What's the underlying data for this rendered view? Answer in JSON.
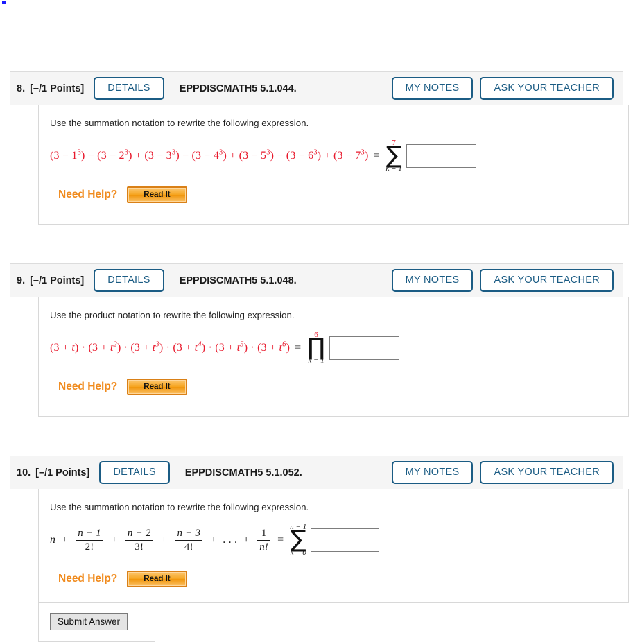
{
  "page": {
    "background_color": "#ffffff",
    "accent_blue": "#1b5c84",
    "expression_red": "#e8192c",
    "help_orange": "#f08b1e"
  },
  "common": {
    "details_label": "DETAILS",
    "my_notes_label": "MY NOTES",
    "ask_your_teacher_label": "ASK YOUR TEACHER",
    "need_help_label": "Need Help?",
    "read_it_label": "Read It",
    "points_label": "[–/1 Points]",
    "answer_placeholder": ""
  },
  "questions": [
    {
      "number": "8.",
      "points": "[–/1 Points]",
      "tag": "EPPDISCMATH5 5.1.044.",
      "prompt": "Use the summation notation to rewrite the following expression.",
      "expression_plain": "(3 − 1³) − (3 − 2³) + (3 − 3³) − (3 − 4³) + (3 − 5³) − (3 − 6³) + (3 − 7³)",
      "terms": [
        {
          "sign": "",
          "base": "3",
          "op": "−",
          "term": "1",
          "exp": "3"
        },
        {
          "sign": "−",
          "base": "3",
          "op": "−",
          "term": "2",
          "exp": "3"
        },
        {
          "sign": "+",
          "base": "3",
          "op": "−",
          "term": "3",
          "exp": "3"
        },
        {
          "sign": "−",
          "base": "3",
          "op": "−",
          "term": "4",
          "exp": "3"
        },
        {
          "sign": "+",
          "base": "3",
          "op": "−",
          "term": "5",
          "exp": "3"
        },
        {
          "sign": "−",
          "base": "3",
          "op": "−",
          "term": "6",
          "exp": "3"
        },
        {
          "sign": "+",
          "base": "3",
          "op": "−",
          "term": "7",
          "exp": "3"
        }
      ],
      "equals": "=",
      "operator": {
        "glyph": "∑",
        "name": "sigma-summation",
        "upper": "7",
        "lower": "k = 1",
        "upper_color": "#e8192c"
      },
      "answer_value": ""
    },
    {
      "number": "9.",
      "points": "[–/1 Points]",
      "tag": "EPPDISCMATH5 5.1.048.",
      "prompt": "Use the product notation to rewrite the following expression.",
      "expression_plain": "(3 + t) · (3 + t²) · (3 + t³) · (3 + t⁴) · (3 + t⁵) · (3 + t⁶)",
      "terms": [
        {
          "sep": "",
          "base": "3",
          "op": "+",
          "term": "t",
          "exp": ""
        },
        {
          "sep": "·",
          "base": "3",
          "op": "+",
          "term": "t",
          "exp": "2"
        },
        {
          "sep": "·",
          "base": "3",
          "op": "+",
          "term": "t",
          "exp": "3"
        },
        {
          "sep": "·",
          "base": "3",
          "op": "+",
          "term": "t",
          "exp": "4"
        },
        {
          "sep": "·",
          "base": "3",
          "op": "+",
          "term": "t",
          "exp": "5"
        },
        {
          "sep": "·",
          "base": "3",
          "op": "+",
          "term": "t",
          "exp": "6"
        }
      ],
      "equals": "=",
      "operator": {
        "glyph": "∏",
        "name": "pi-product",
        "upper": "6",
        "lower": "k = 1",
        "upper_color": "#e8192c"
      },
      "answer_value": ""
    },
    {
      "number": "10.",
      "points": "[–/1 Points]",
      "tag": "EPPDISCMATH5 5.1.052.",
      "prompt": "Use the summation notation to rewrite the following expression.",
      "expression_plain": "n + (n − 1)/2! + (n − 2)/3! + (n − 3)/4! + . . . + 1/n!",
      "lead_term": "n",
      "fractions": [
        {
          "num": "n − 1",
          "den": "2!"
        },
        {
          "num": "n − 2",
          "den": "3!"
        },
        {
          "num": "n − 3",
          "den": "4!"
        },
        {
          "num": "1",
          "den": "n!"
        }
      ],
      "ellipsis": ". . .",
      "plus": "+",
      "equals": "=",
      "operator": {
        "glyph": "∑",
        "name": "sigma-summation",
        "upper": "n − 1",
        "lower": "k = 0",
        "upper_color": "#1a1a1a"
      },
      "answer_value": ""
    }
  ],
  "footer": {
    "submit_label": "Submit Answer"
  }
}
